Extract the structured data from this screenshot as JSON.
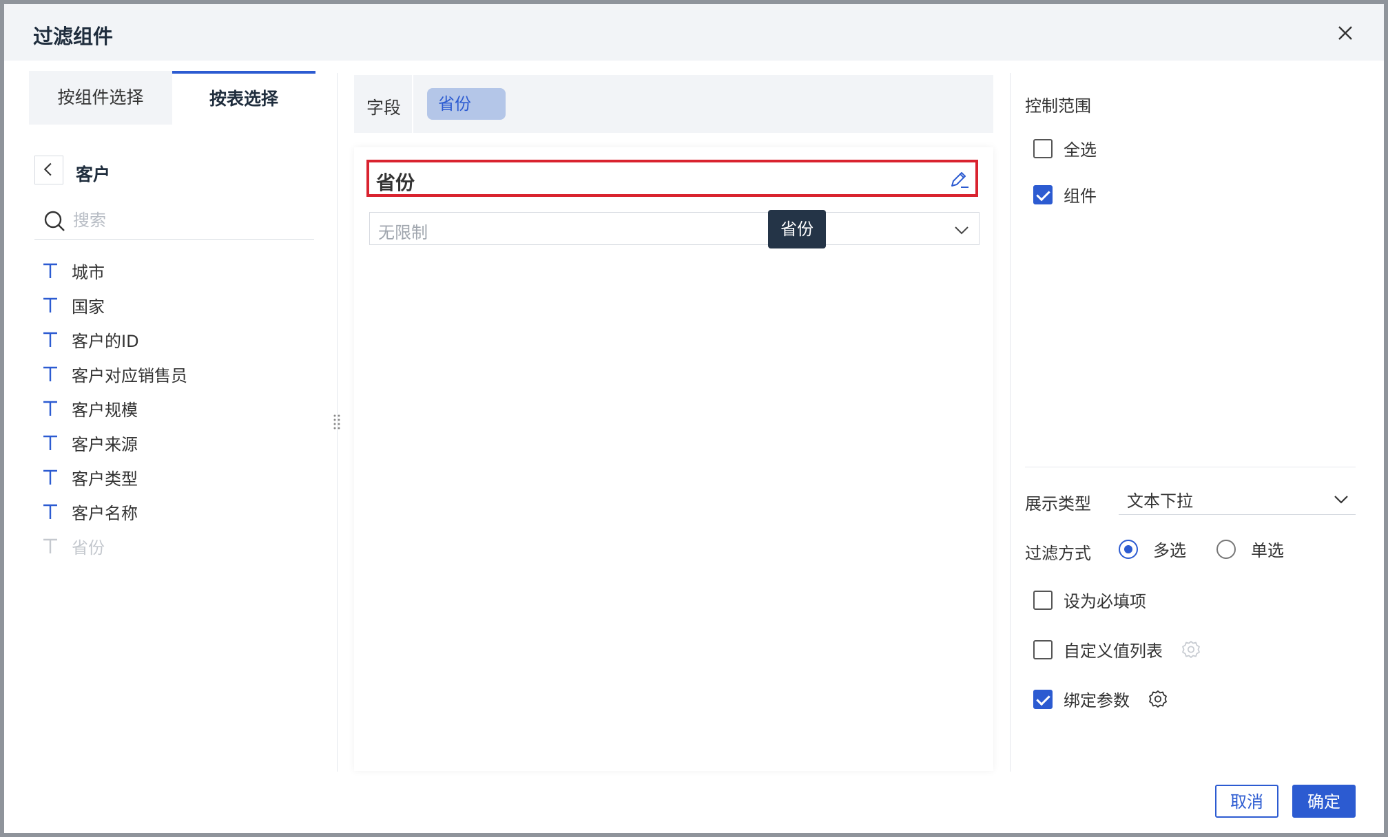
{
  "dialog": {
    "title": "过滤组件"
  },
  "left": {
    "tabs": [
      {
        "label": "按组件选择",
        "active": false
      },
      {
        "label": "按表选择",
        "active": true
      }
    ],
    "table_name": "客户",
    "search_placeholder": "搜索",
    "fields": [
      {
        "label": "城市",
        "icon": "text-field-icon",
        "disabled": false
      },
      {
        "label": "国家",
        "icon": "text-field-icon",
        "disabled": false
      },
      {
        "label": "客户的ID",
        "icon": "text-field-icon",
        "disabled": false
      },
      {
        "label": "客户对应销售员",
        "icon": "text-field-icon",
        "disabled": false
      },
      {
        "label": "客户规模",
        "icon": "text-field-icon",
        "disabled": false
      },
      {
        "label": "客户来源",
        "icon": "text-field-icon",
        "disabled": false
      },
      {
        "label": "客户类型",
        "icon": "text-field-icon",
        "disabled": false
      },
      {
        "label": "客户名称",
        "icon": "text-field-icon",
        "disabled": false
      },
      {
        "label": "省份",
        "icon": "text-field-icon",
        "disabled": true
      }
    ]
  },
  "middle": {
    "field_label": "字段",
    "field_chip": "省份",
    "preview_title": "省份",
    "select_placeholder": "无限制",
    "tooltip": "省份"
  },
  "right": {
    "scope_title": "控制范围",
    "scope_options": [
      {
        "label": "全选",
        "checked": false
      },
      {
        "label": "组件",
        "checked": true
      }
    ],
    "display_type_label": "展示类型",
    "display_type_value": "文本下拉",
    "filter_mode_label": "过滤方式",
    "filter_modes": [
      {
        "label": "多选",
        "selected": true
      },
      {
        "label": "单选",
        "selected": false
      }
    ],
    "required_label": "设为必填项",
    "custom_list_label": "自定义值列表",
    "bind_param_label": "绑定参数"
  },
  "footer": {
    "cancel_label": "取消",
    "ok_label": "确定"
  },
  "colors": {
    "primary": "#2c5bd1",
    "highlight_border": "#d9232f",
    "tooltip_bg": "#243447"
  }
}
